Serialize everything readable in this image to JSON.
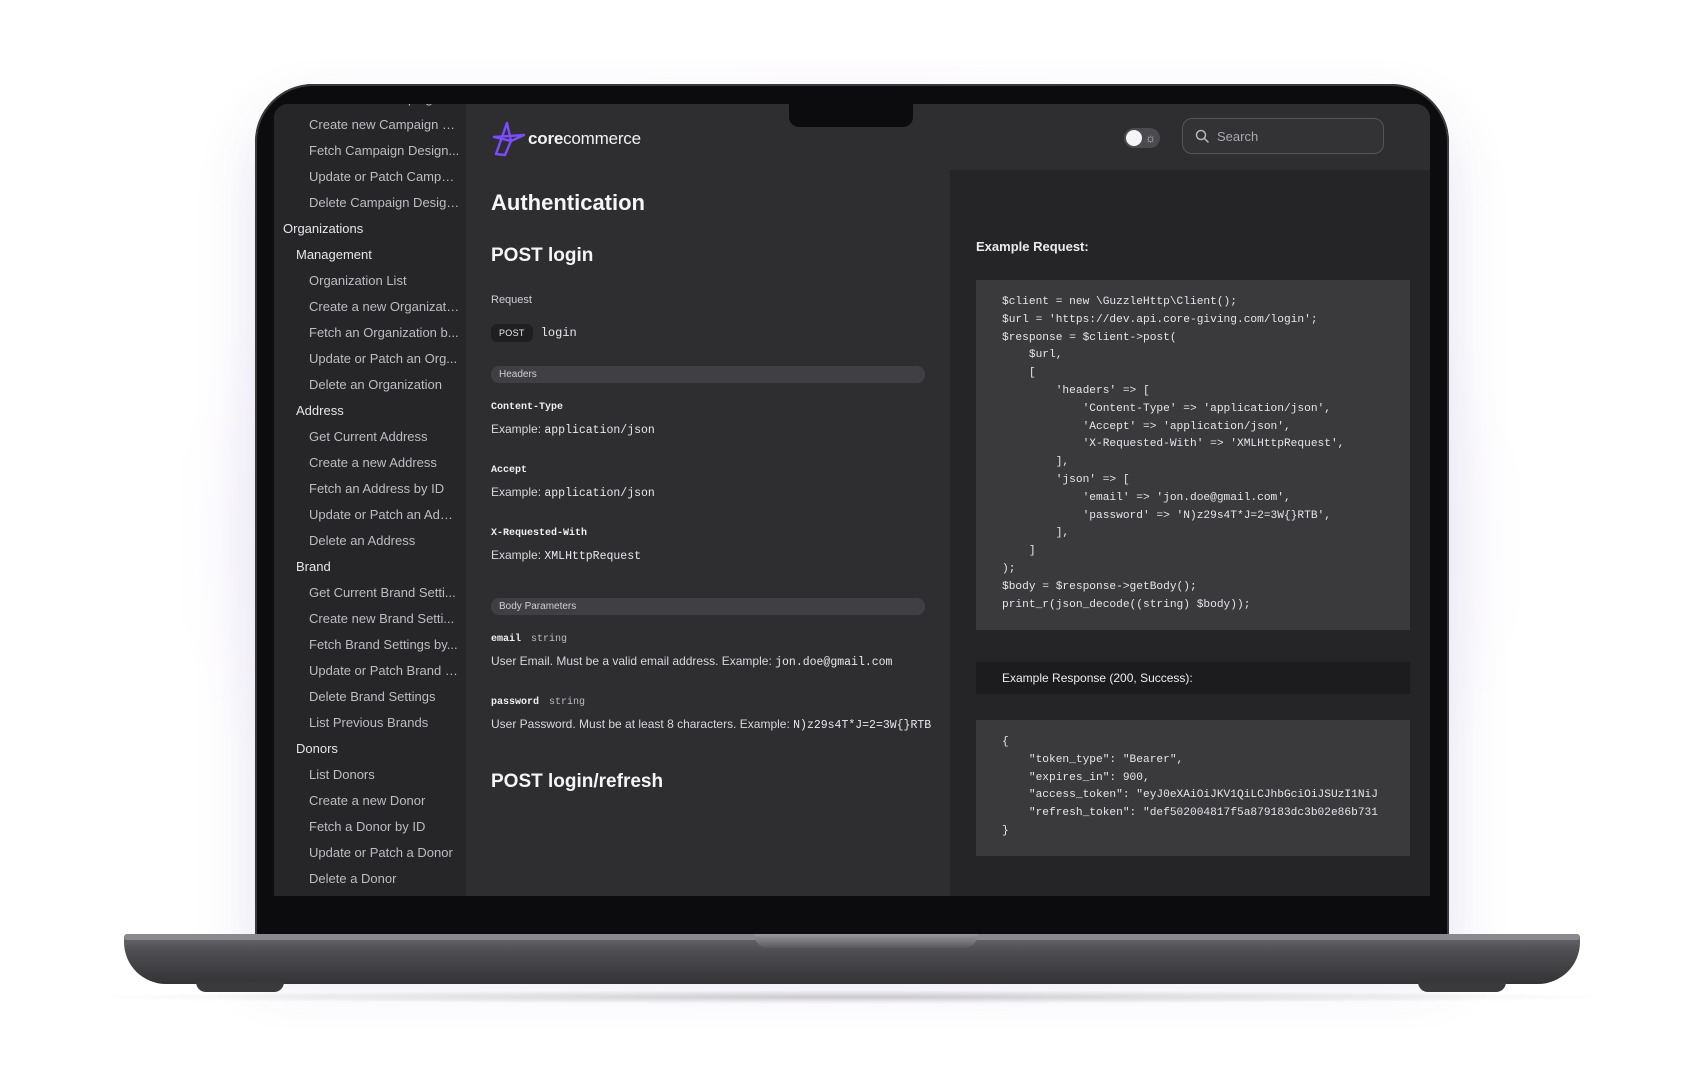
{
  "sidebar": {
    "items": [
      {
        "label": "Get Current Campaign D...",
        "level": 2
      },
      {
        "label": "Create new Campaign D...",
        "level": 2
      },
      {
        "label": "Fetch Campaign Design...",
        "level": 2
      },
      {
        "label": "Update or Patch Campai...",
        "level": 2
      },
      {
        "label": "Delete Campaign Design...",
        "level": 2
      },
      {
        "label": "Organizations",
        "level": 0
      },
      {
        "label": "Management",
        "level": 1
      },
      {
        "label": "Organization List",
        "level": 2
      },
      {
        "label": "Create a new Organizati...",
        "level": 2
      },
      {
        "label": "Fetch an Organization b...",
        "level": 2
      },
      {
        "label": "Update or Patch an Org...",
        "level": 2
      },
      {
        "label": "Delete an Organization",
        "level": 2
      },
      {
        "label": "Address",
        "level": 1
      },
      {
        "label": "Get Current Address",
        "level": 2
      },
      {
        "label": "Create a new Address",
        "level": 2
      },
      {
        "label": "Fetch an Address by ID",
        "level": 2
      },
      {
        "label": "Update or Patch an Addr...",
        "level": 2
      },
      {
        "label": "Delete an Address",
        "level": 2
      },
      {
        "label": "Brand",
        "level": 1
      },
      {
        "label": "Get Current Brand Setti...",
        "level": 2
      },
      {
        "label": "Create new Brand Setti...",
        "level": 2
      },
      {
        "label": "Fetch Brand Settings by...",
        "level": 2
      },
      {
        "label": "Update or Patch Brand S...",
        "level": 2
      },
      {
        "label": "Delete Brand Settings",
        "level": 2
      },
      {
        "label": "List Previous Brands",
        "level": 2
      },
      {
        "label": "Donors",
        "level": 1
      },
      {
        "label": "List Donors",
        "level": 2
      },
      {
        "label": "Create a new Donor",
        "level": 2
      },
      {
        "label": "Fetch a Donor by ID",
        "level": 2
      },
      {
        "label": "Update or Patch a Donor",
        "level": 2
      },
      {
        "label": "Delete a Donor",
        "level": 2
      }
    ]
  },
  "header": {
    "logo_core": "core",
    "logo_commerce": "commerce",
    "search_placeholder": "Search",
    "logo_color": "#7b4dff"
  },
  "main": {
    "title": "Authentication",
    "endpoint1": {
      "heading": "POST login",
      "request_label": "Request",
      "method": "POST",
      "path": "login",
      "headers_section": "Headers",
      "headers": [
        {
          "name": "Content-Type",
          "example_label": "Example:",
          "example": "application/json"
        },
        {
          "name": "Accept",
          "example_label": "Example:",
          "example": "application/json"
        },
        {
          "name": "X-Requested-With",
          "example_label": "Example:",
          "example": "XMLHttpRequest"
        }
      ],
      "body_section": "Body Parameters",
      "body_params": [
        {
          "name": "email",
          "type": "string",
          "desc": "User Email. Must be a valid email address. Example:",
          "example": "jon.doe@gmail.com"
        },
        {
          "name": "password",
          "type": "string",
          "desc": "User Password. Must be at least 8 characters. Example:",
          "example": "N)z29s4T*J=2=3W{}RTB"
        }
      ]
    },
    "endpoint2": {
      "heading": "POST login/refresh"
    }
  },
  "right": {
    "request_label": "Example Request:",
    "request_code": "$client = new \\GuzzleHttp\\Client();\n$url = 'https://dev.api.core-giving.com/login';\n$response = $client->post(\n    $url,\n    [\n        'headers' => [\n            'Content-Type' => 'application/json',\n            'Accept' => 'application/json',\n            'X-Requested-With' => 'XMLHttpRequest',\n        ],\n        'json' => [\n            'email' => 'jon.doe@gmail.com',\n            'password' => 'N)z29s4T*J=2=3W{}RTB',\n        ],\n    ]\n);\n$body = $response->getBody();\nprint_r(json_decode((string) $body));",
    "response_label": "Example Response (200, Success):",
    "response_code": "{\n    \"token_type\": \"Bearer\",\n    \"expires_in\": 900,\n    \"access_token\": \"eyJ0eXAiOiJKV1QiLCJhbGciOiJSUzI1NiJ\n    \"refresh_token\": \"def502004817f5a879183dc3b02e86b731\n}"
  }
}
